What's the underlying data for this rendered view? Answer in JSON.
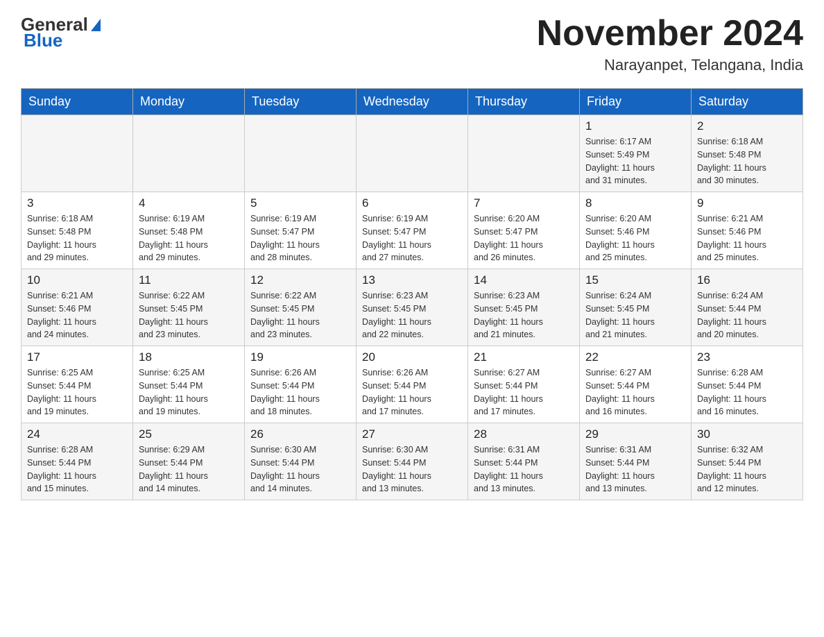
{
  "logo": {
    "general": "General",
    "blue": "Blue"
  },
  "header": {
    "month": "November 2024",
    "location": "Narayanpet, Telangana, India"
  },
  "weekdays": [
    "Sunday",
    "Monday",
    "Tuesday",
    "Wednesday",
    "Thursday",
    "Friday",
    "Saturday"
  ],
  "weeks": [
    [
      {
        "day": "",
        "info": ""
      },
      {
        "day": "",
        "info": ""
      },
      {
        "day": "",
        "info": ""
      },
      {
        "day": "",
        "info": ""
      },
      {
        "day": "",
        "info": ""
      },
      {
        "day": "1",
        "info": "Sunrise: 6:17 AM\nSunset: 5:49 PM\nDaylight: 11 hours\nand 31 minutes."
      },
      {
        "day": "2",
        "info": "Sunrise: 6:18 AM\nSunset: 5:48 PM\nDaylight: 11 hours\nand 30 minutes."
      }
    ],
    [
      {
        "day": "3",
        "info": "Sunrise: 6:18 AM\nSunset: 5:48 PM\nDaylight: 11 hours\nand 29 minutes."
      },
      {
        "day": "4",
        "info": "Sunrise: 6:19 AM\nSunset: 5:48 PM\nDaylight: 11 hours\nand 29 minutes."
      },
      {
        "day": "5",
        "info": "Sunrise: 6:19 AM\nSunset: 5:47 PM\nDaylight: 11 hours\nand 28 minutes."
      },
      {
        "day": "6",
        "info": "Sunrise: 6:19 AM\nSunset: 5:47 PM\nDaylight: 11 hours\nand 27 minutes."
      },
      {
        "day": "7",
        "info": "Sunrise: 6:20 AM\nSunset: 5:47 PM\nDaylight: 11 hours\nand 26 minutes."
      },
      {
        "day": "8",
        "info": "Sunrise: 6:20 AM\nSunset: 5:46 PM\nDaylight: 11 hours\nand 25 minutes."
      },
      {
        "day": "9",
        "info": "Sunrise: 6:21 AM\nSunset: 5:46 PM\nDaylight: 11 hours\nand 25 minutes."
      }
    ],
    [
      {
        "day": "10",
        "info": "Sunrise: 6:21 AM\nSunset: 5:46 PM\nDaylight: 11 hours\nand 24 minutes."
      },
      {
        "day": "11",
        "info": "Sunrise: 6:22 AM\nSunset: 5:45 PM\nDaylight: 11 hours\nand 23 minutes."
      },
      {
        "day": "12",
        "info": "Sunrise: 6:22 AM\nSunset: 5:45 PM\nDaylight: 11 hours\nand 23 minutes."
      },
      {
        "day": "13",
        "info": "Sunrise: 6:23 AM\nSunset: 5:45 PM\nDaylight: 11 hours\nand 22 minutes."
      },
      {
        "day": "14",
        "info": "Sunrise: 6:23 AM\nSunset: 5:45 PM\nDaylight: 11 hours\nand 21 minutes."
      },
      {
        "day": "15",
        "info": "Sunrise: 6:24 AM\nSunset: 5:45 PM\nDaylight: 11 hours\nand 21 minutes."
      },
      {
        "day": "16",
        "info": "Sunrise: 6:24 AM\nSunset: 5:44 PM\nDaylight: 11 hours\nand 20 minutes."
      }
    ],
    [
      {
        "day": "17",
        "info": "Sunrise: 6:25 AM\nSunset: 5:44 PM\nDaylight: 11 hours\nand 19 minutes."
      },
      {
        "day": "18",
        "info": "Sunrise: 6:25 AM\nSunset: 5:44 PM\nDaylight: 11 hours\nand 19 minutes."
      },
      {
        "day": "19",
        "info": "Sunrise: 6:26 AM\nSunset: 5:44 PM\nDaylight: 11 hours\nand 18 minutes."
      },
      {
        "day": "20",
        "info": "Sunrise: 6:26 AM\nSunset: 5:44 PM\nDaylight: 11 hours\nand 17 minutes."
      },
      {
        "day": "21",
        "info": "Sunrise: 6:27 AM\nSunset: 5:44 PM\nDaylight: 11 hours\nand 17 minutes."
      },
      {
        "day": "22",
        "info": "Sunrise: 6:27 AM\nSunset: 5:44 PM\nDaylight: 11 hours\nand 16 minutes."
      },
      {
        "day": "23",
        "info": "Sunrise: 6:28 AM\nSunset: 5:44 PM\nDaylight: 11 hours\nand 16 minutes."
      }
    ],
    [
      {
        "day": "24",
        "info": "Sunrise: 6:28 AM\nSunset: 5:44 PM\nDaylight: 11 hours\nand 15 minutes."
      },
      {
        "day": "25",
        "info": "Sunrise: 6:29 AM\nSunset: 5:44 PM\nDaylight: 11 hours\nand 14 minutes."
      },
      {
        "day": "26",
        "info": "Sunrise: 6:30 AM\nSunset: 5:44 PM\nDaylight: 11 hours\nand 14 minutes."
      },
      {
        "day": "27",
        "info": "Sunrise: 6:30 AM\nSunset: 5:44 PM\nDaylight: 11 hours\nand 13 minutes."
      },
      {
        "day": "28",
        "info": "Sunrise: 6:31 AM\nSunset: 5:44 PM\nDaylight: 11 hours\nand 13 minutes."
      },
      {
        "day": "29",
        "info": "Sunrise: 6:31 AM\nSunset: 5:44 PM\nDaylight: 11 hours\nand 13 minutes."
      },
      {
        "day": "30",
        "info": "Sunrise: 6:32 AM\nSunset: 5:44 PM\nDaylight: 11 hours\nand 12 minutes."
      }
    ]
  ]
}
